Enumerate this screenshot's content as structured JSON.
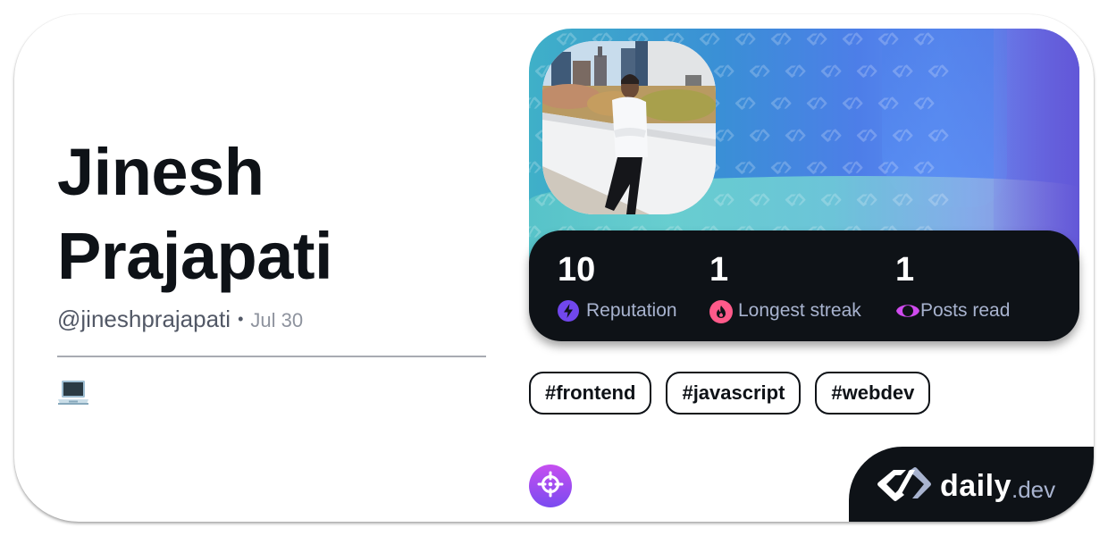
{
  "profile": {
    "name": "Jinesh Prajapati",
    "username": "@jineshprajapati",
    "separator": "•",
    "joined_date": "Jul 30",
    "bio_emoji": "laptop-emoji"
  },
  "stats": [
    {
      "value": "10",
      "label": "Reputation",
      "icon": "lightning-icon",
      "color": "#7147ed"
    },
    {
      "value": "1",
      "label": "Longest streak",
      "icon": "flame-icon",
      "color": "#ff5a8a"
    },
    {
      "value": "1",
      "label": "Posts read",
      "icon": "eye-ring-icon",
      "color": "#d04bef"
    }
  ],
  "tags": [
    "#frontend",
    "#javascript",
    "#webdev"
  ],
  "squad_badge": {
    "icon": "crosshair-icon"
  },
  "brand": {
    "name_primary": "daily",
    "name_suffix": ".dev",
    "icon": "daily-dev-logo-icon"
  },
  "colors": {
    "text_primary": "#0e1217",
    "text_secondary": "#525866",
    "text_tertiary": "#8e939e",
    "stat_label": "#a8b3cf",
    "dark_surface": "#0e1217"
  }
}
